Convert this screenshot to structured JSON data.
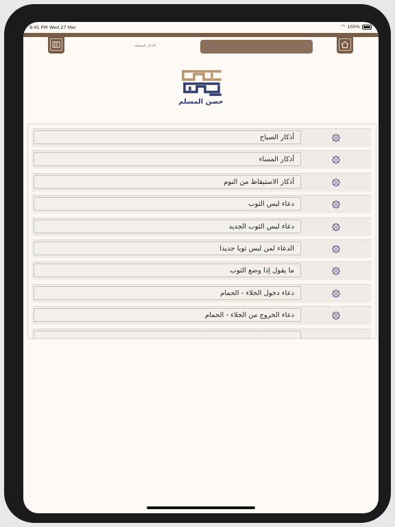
{
  "status_bar": {
    "time": "9:41 PM",
    "date": "Wed 27 Mar",
    "battery": "100%"
  },
  "header": {
    "subtitle": "الأذكار المفضلة",
    "left_icon": "bookmark-book-icon",
    "right_icon": "home-icon"
  },
  "logo": {
    "caption": "حصن المسلم"
  },
  "list": {
    "items": [
      {
        "label": "أذكار الصباح"
      },
      {
        "label": "أذكار المساء"
      },
      {
        "label": "أذكار الاستيقاظ من النوم"
      },
      {
        "label": "دعاء لبس الثوب"
      },
      {
        "label": "دعاء لبس الثوب الجديد"
      },
      {
        "label": "الدعاء لمن لبس ثوبا جديدا"
      },
      {
        "label": "ما يقول إذا وضع الثوب"
      },
      {
        "label": "دعاء دخول الخلاء - الحمام"
      },
      {
        "label": "دعاء الخروج من الخلاء - الحمام"
      }
    ],
    "row_icon": "star-ornament-icon"
  },
  "colors": {
    "brand_brown": "#7a5d49",
    "search_bar": "#8a6f5d",
    "logo_gold": "#b8936b",
    "logo_navy": "#2e3d6e",
    "background": "#fdf9f4"
  }
}
